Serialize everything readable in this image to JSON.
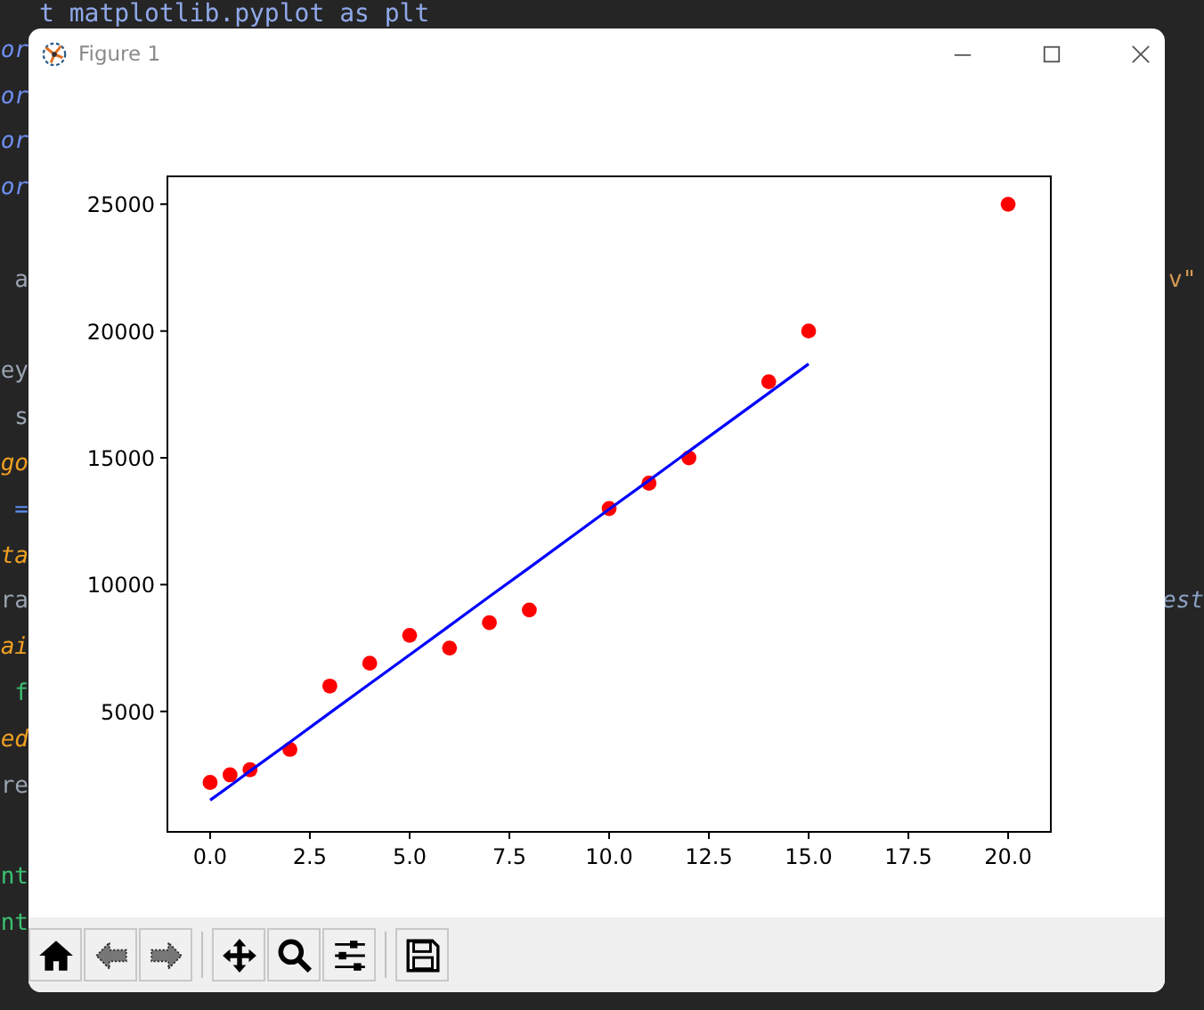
{
  "editor": {
    "top_line": {
      "text": "t matplotlib.pyplot as plt",
      "color": "#8fa8e8"
    },
    "rows": [
      {
        "left": {
          "text": "or",
          "color": "#6f8ff0",
          "italic": true
        }
      },
      {
        "left": {
          "text": "or",
          "color": "#6f8ff0",
          "italic": true
        }
      },
      {
        "left": {
          "text": "or",
          "color": "#6f8ff0",
          "italic": true
        }
      },
      {
        "left": {
          "text": "or",
          "color": "#6f8ff0",
          "italic": true
        }
      },
      {},
      {
        "left": {
          "text": "a",
          "color": "#9aa4b0",
          "italic": false
        },
        "right": {
          "text": "v\"",
          "color": "#d49a50",
          "italic": false
        }
      },
      {},
      {
        "left": {
          "text": "ey",
          "color": "#9aa4b0",
          "italic": false
        }
      },
      {
        "left": {
          "text": "s",
          "color": "#9aa4b0",
          "italic": false
        }
      },
      {
        "left": {
          "text": "go",
          "color": "#f0a020",
          "italic": true
        }
      },
      {
        "left": {
          "text": "=",
          "color": "#5b8ef0"
        }
      },
      {
        "left": {
          "text": "ta",
          "color": "#f0a020",
          "italic": true
        }
      },
      {
        "left": {
          "text": "ra",
          "color": "#9aa4b0",
          "italic": false
        },
        "right": {
          "text": "est",
          "color": "#8aa0c0",
          "italic": true
        }
      },
      {
        "left": {
          "text": "ai",
          "color": "#f0a020",
          "italic": true
        }
      },
      {
        "left": {
          "text": "f",
          "color": "#3cc070",
          "italic": false
        }
      },
      {
        "left": {
          "text": "ed",
          "color": "#f0a020",
          "italic": true
        }
      },
      {
        "left": {
          "text": "re",
          "color": "#9aa4b0",
          "italic": false
        }
      },
      {},
      {
        "left": {
          "text": "nt",
          "color": "#3cc070",
          "italic": false
        }
      },
      {
        "left": {
          "text": "nt",
          "color": "#3cc070",
          "italic": false
        }
      }
    ]
  },
  "window": {
    "title": "Figure 1",
    "figure": {
      "chart_data": {
        "type": "scatter",
        "x": [
          0,
          0.5,
          1,
          2,
          3,
          4,
          5,
          6,
          7,
          8,
          10,
          11,
          12,
          14,
          15,
          20
        ],
        "series": [
          {
            "type": "scatter",
            "color": "#ff0000",
            "values": [
              2200,
              2500,
              2700,
              3500,
              6000,
              6900,
              8000,
              7500,
              8500,
              9000,
              13000,
              14000,
              15000,
              18000,
              20000,
              25000
            ]
          },
          {
            "type": "line",
            "color": "#0000ff",
            "values": [
              1500,
              2070,
              2650,
              3790,
              4940,
              6090,
              7230,
              8380,
              9530,
              10670,
              12970,
              14110,
              15260,
              17550,
              18700,
              null
            ]
          }
        ],
        "xlim": [
          -1.07,
          21.07
        ],
        "ylim": [
          250,
          26100
        ],
        "xticks": [
          {
            "value": 0,
            "label": "0.0"
          },
          {
            "value": 2.5,
            "label": "2.5"
          },
          {
            "value": 5,
            "label": "5.0"
          },
          {
            "value": 7.5,
            "label": "7.5"
          },
          {
            "value": 10,
            "label": "10.0"
          },
          {
            "value": 12.5,
            "label": "12.5"
          },
          {
            "value": 15,
            "label": "15.0"
          },
          {
            "value": 17.5,
            "label": "17.5"
          },
          {
            "value": 20,
            "label": "20.0"
          }
        ],
        "yticks": [
          5000,
          10000,
          15000,
          20000,
          25000
        ]
      }
    },
    "toolbar": [
      {
        "kind": "home"
      },
      {
        "kind": "back"
      },
      {
        "kind": "forward"
      },
      {
        "kind": "separator"
      },
      {
        "kind": "pan"
      },
      {
        "kind": "zoom"
      },
      {
        "kind": "configure"
      },
      {
        "kind": "separator"
      },
      {
        "kind": "save"
      }
    ]
  }
}
